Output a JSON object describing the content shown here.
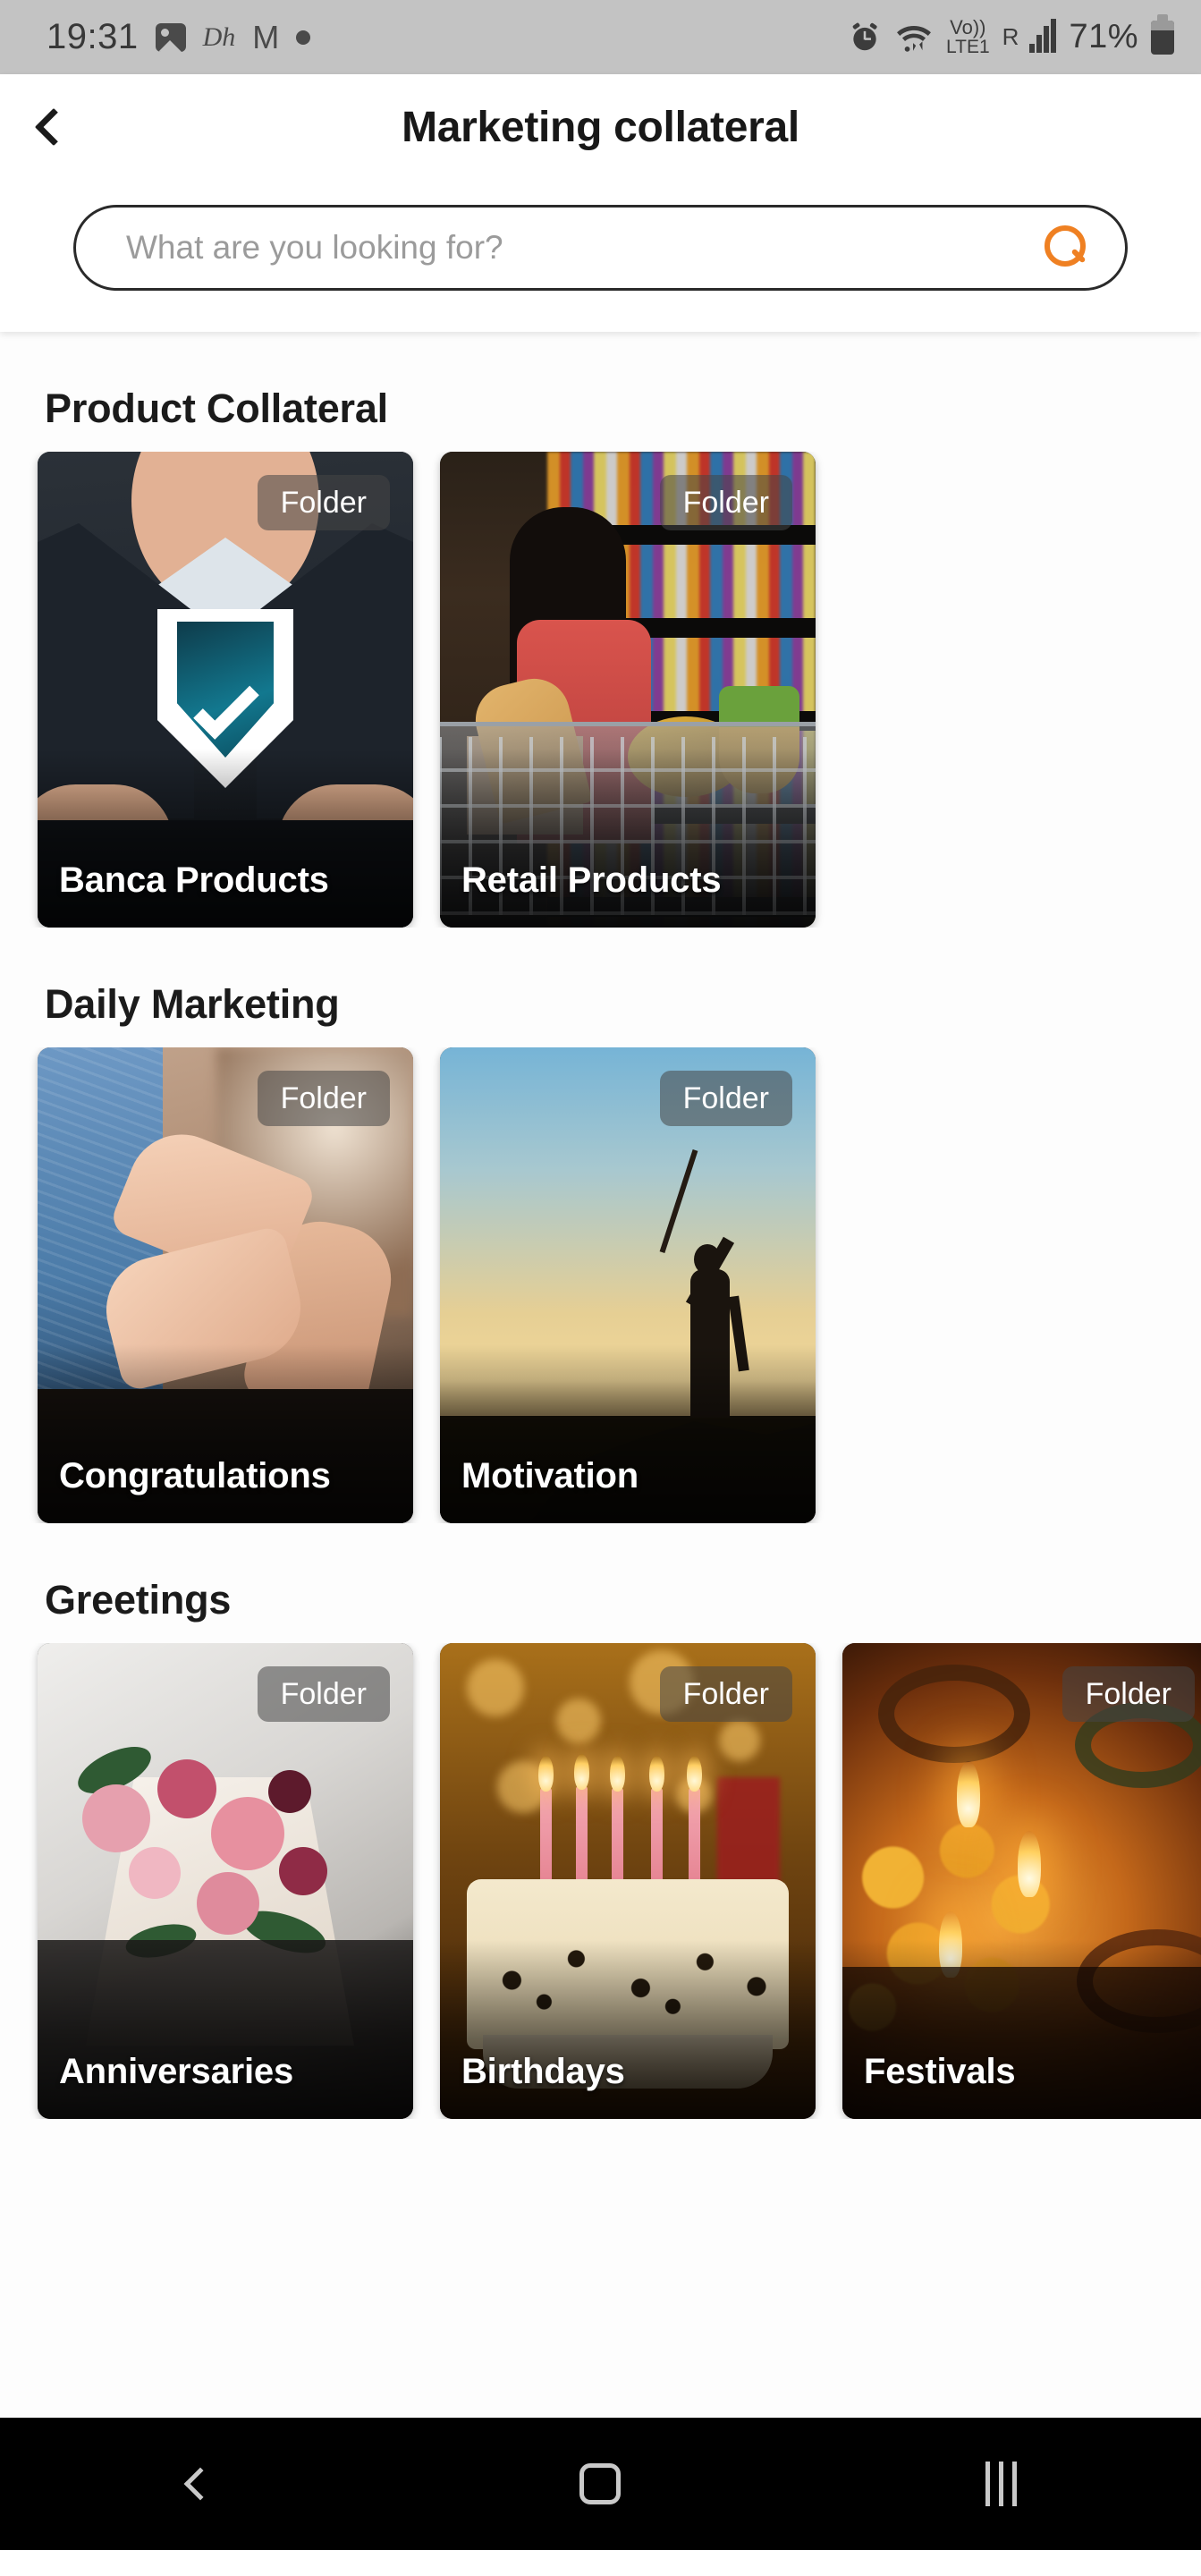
{
  "status_bar": {
    "time": "19:31",
    "left_icons": [
      "photo-icon",
      "hotstar-icon",
      "gmail-icon",
      "dot-icon"
    ],
    "hotstar_label": "Dh",
    "gmail_label": "M",
    "alarm_icon": "alarm-icon",
    "wifi_icon": "wifi-icon",
    "volte_top": "Vo))",
    "volte_bottom": "LTE1",
    "roaming_label": "R",
    "battery_percent": "71%"
  },
  "header": {
    "back_label": "Back",
    "title": "Marketing collateral"
  },
  "search": {
    "placeholder": "What are you looking for?",
    "value": "",
    "icon": "search-icon",
    "accent_color": "#ef8022"
  },
  "badge_label": "Folder",
  "sections": [
    {
      "title": "Product Collateral",
      "cards": [
        {
          "label": "Banca Products",
          "badge": "Folder",
          "art": "art-banca"
        },
        {
          "label": "Retail Products",
          "badge": "Folder",
          "art": "art-retail"
        }
      ]
    },
    {
      "title": "Daily Marketing",
      "cards": [
        {
          "label": "Congratulations",
          "badge": "Folder",
          "art": "art-clap"
        },
        {
          "label": "Motivation",
          "badge": "Folder",
          "art": "art-moti"
        }
      ]
    },
    {
      "title": "Greetings",
      "cards": [
        {
          "label": "Anniversaries",
          "badge": "Folder",
          "art": "art-anni"
        },
        {
          "label": "Birthdays",
          "badge": "Folder",
          "art": "art-bday"
        },
        {
          "label": "Festivals",
          "badge": "Folder",
          "art": "art-fest"
        }
      ]
    }
  ],
  "nav_bar": {
    "back": "back-icon",
    "home": "home-icon",
    "recents": "recents-icon"
  }
}
